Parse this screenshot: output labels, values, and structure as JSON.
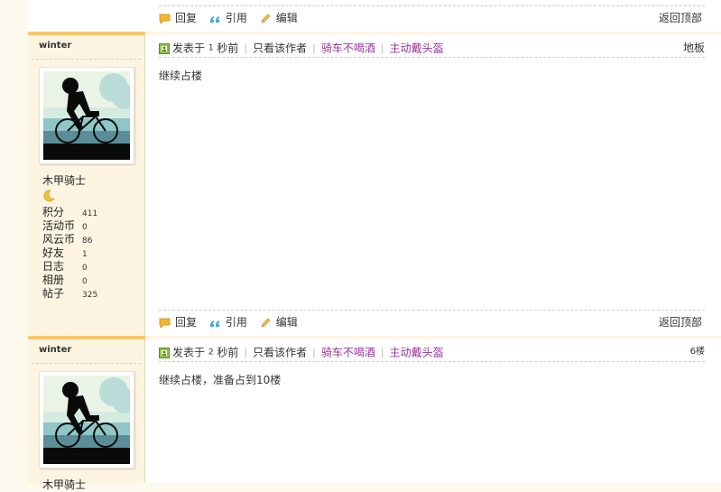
{
  "action_labels": {
    "reply": "回复",
    "quote": "引用",
    "edit": "编辑",
    "back_to_top": "返回顶部"
  },
  "meta_labels": {
    "posted_prefix": "发表于",
    "seconds_ago": "秒前",
    "only_author": "只看该作者"
  },
  "stat_labels": [
    "积分",
    "活动币",
    "风云币",
    "好友",
    "日志",
    "相册",
    "帖子"
  ],
  "user": {
    "name": "winter",
    "nickname": "木甲骑士",
    "stats": [
      "411",
      "0",
      "86",
      "1",
      "0",
      "0",
      "325"
    ],
    "sig_links": [
      "骑车不喝酒",
      "主动戴头盔"
    ]
  },
  "posts": [
    {
      "time_num": "1",
      "floor": "地板",
      "content": "继续占楼"
    },
    {
      "time_num": "2",
      "floor": "6楼",
      "content": "继续占楼，准备占到10楼"
    }
  ],
  "colors": {
    "accent_bar": "#f8c76c",
    "link_purple": "#993399",
    "sidebar_bg": "#fdf5e2"
  }
}
